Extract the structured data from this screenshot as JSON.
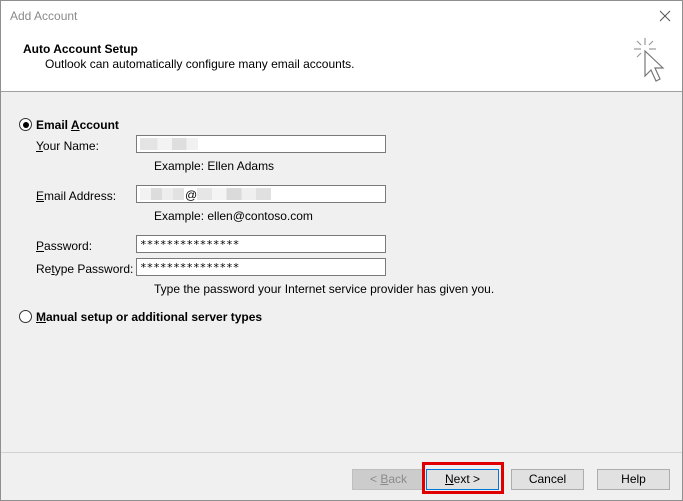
{
  "window": {
    "title": "Add Account"
  },
  "header": {
    "title": "Auto Account Setup",
    "subtitle": "Outlook can automatically configure many email accounts."
  },
  "email_account": {
    "label_before": "Email ",
    "label_underline": "A",
    "label_after": "ccount",
    "selected": true,
    "your_name": {
      "label_underline": "Y",
      "label_after": "our Name:",
      "hint": "Example: Ellen Adams"
    },
    "email_address": {
      "label_underline": "E",
      "label_after": "mail Address:",
      "at_symbol": "@",
      "hint": "Example: ellen@contoso.com"
    },
    "password": {
      "label_underline": "P",
      "label_after": "assword:",
      "value": "***************"
    },
    "retype_password": {
      "label_before": "Re",
      "label_underline": "t",
      "label_after": "ype Password:",
      "value": "***************",
      "hint": "Type the password your Internet service provider has given you."
    }
  },
  "manual_setup": {
    "label_underline": "M",
    "label_after": "anual setup or additional server types",
    "selected": false
  },
  "buttons": {
    "back_before": "< ",
    "back_underline": "B",
    "back_after": "ack",
    "next_underline": "N",
    "next_after": "ext >",
    "cancel": "Cancel",
    "help": "Help"
  },
  "colors": {
    "highlight": "#e00000",
    "focus_border": "#0078d7"
  },
  "icons": {
    "close": "close-icon",
    "wizard": "cursor-sparkle-icon"
  }
}
